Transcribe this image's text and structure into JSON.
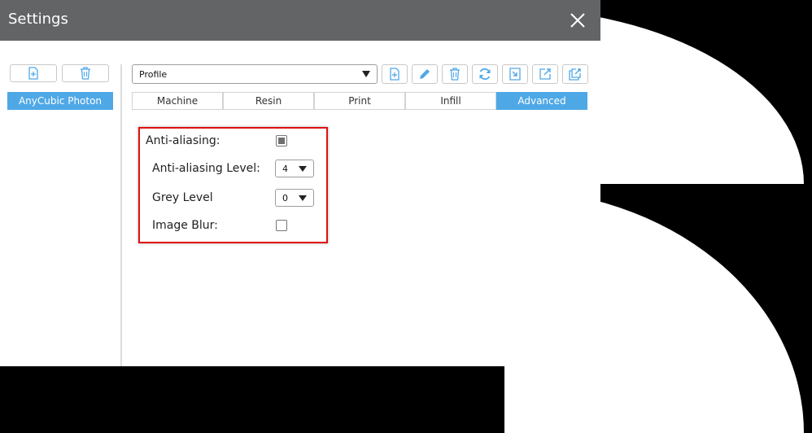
{
  "window": {
    "title": "Settings"
  },
  "printers": {
    "items": [
      {
        "label": "AnyCubic Photon"
      }
    ]
  },
  "profile": {
    "selected": "Profile"
  },
  "tabs": [
    {
      "label": "Machine"
    },
    {
      "label": "Resin"
    },
    {
      "label": "Print"
    },
    {
      "label": "Infill"
    },
    {
      "label": "Advanced"
    }
  ],
  "advanced": {
    "anti_aliasing_label": "Anti-aliasing:",
    "anti_aliasing_checked": true,
    "anti_aliasing_level_label": "Anti-aliasing Level:",
    "anti_aliasing_level_value": "4",
    "grey_level_label": "Grey Level",
    "grey_level_value": "0",
    "image_blur_label": "Image Blur:",
    "image_blur_checked": false
  },
  "colors": {
    "titlebar": "#636466",
    "accent": "#4fa8e6",
    "highlight": "#e01010"
  }
}
